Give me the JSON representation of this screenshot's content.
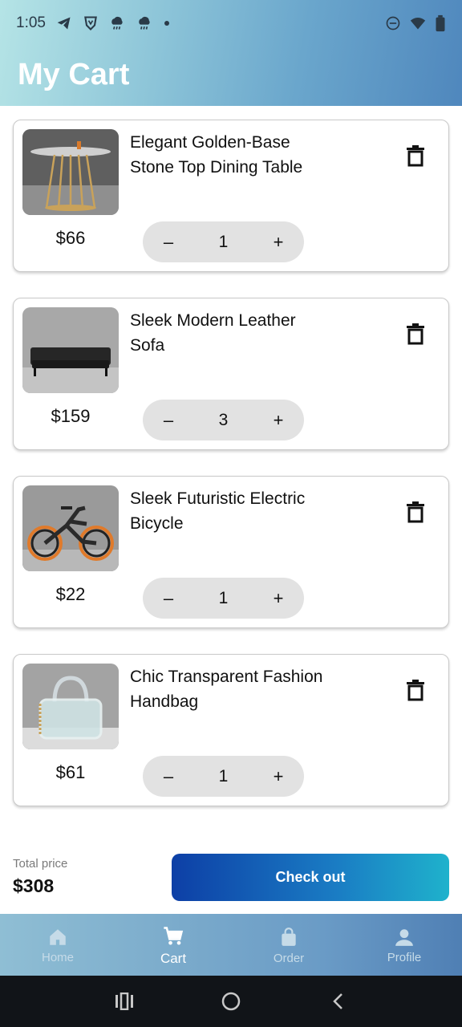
{
  "status_bar": {
    "time": "1:05"
  },
  "header": {
    "title": "My Cart"
  },
  "cart": {
    "items": [
      {
        "name": "Elegant Golden-Base Stone Top Dining Table",
        "price": "$66",
        "quantity": "1",
        "image_icon": "dining-table-image"
      },
      {
        "name": "Sleek Modern Leather Sofa",
        "price": "$159",
        "quantity": "3",
        "image_icon": "sofa-image"
      },
      {
        "name": "Sleek Futuristic Electric Bicycle",
        "price": "$22",
        "quantity": "1",
        "image_icon": "electric-bicycle-image"
      },
      {
        "name": "Chic Transparent Fashion Handbag",
        "price": "$61",
        "quantity": "1",
        "image_icon": "handbag-image"
      }
    ],
    "decrement_symbol": "–",
    "increment_symbol": "+"
  },
  "summary": {
    "total_label": "Total price",
    "total_value": "$308",
    "checkout_label": "Check out"
  },
  "bottom_nav": {
    "items": [
      {
        "label": "Home",
        "icon": "home-icon",
        "active": false
      },
      {
        "label": "Cart",
        "icon": "cart-icon",
        "active": true
      },
      {
        "label": "Order",
        "icon": "bag-icon",
        "active": false
      },
      {
        "label": "Profile",
        "icon": "person-icon",
        "active": false
      }
    ]
  },
  "colors": {
    "accent_start": "#0d3fa6",
    "accent_end": "#1fb2cc",
    "stepper_bg": "#e2e2e2"
  }
}
